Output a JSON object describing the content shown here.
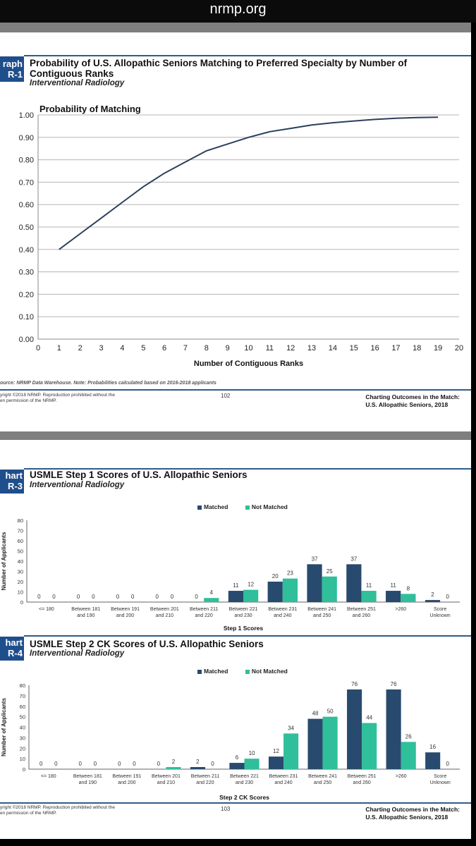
{
  "browser": {
    "url": "nrmp.org"
  },
  "colors": {
    "matched": "#284a6e",
    "not_matched": "#2fbf9a",
    "line": "#2b3f5c",
    "header_blue": "#1f4e8c"
  },
  "page1": {
    "tag_line1": "raph",
    "tag_line2": "R-1",
    "title_line1": "Probability of U.S. Allopathic Seniors Matching to Preferred Specialty by Number of",
    "title_line2": "Contiguous Ranks",
    "subtitle": "Interventional Radiology",
    "source": "ource: NRMP Data Warehouse. Note: Probabilities calculated based on 2016-2018 applicants",
    "copyright_line1": "yright ©2018 NRMP. Reproduction prohibited without the",
    "copyright_line2": "en permission of the NRMP.",
    "page_number": "102",
    "footer_title_line1": "Charting Outcomes in the Match:",
    "footer_title_line2": "U.S. Allopathic Seniors, 2018"
  },
  "page2": {
    "chart3": {
      "tag_line1": "hart",
      "tag_line2": "R-3",
      "title": "USMLE Step 1 Scores of U.S. Allopathic Seniors",
      "subtitle": "Interventional Radiology"
    },
    "chart4": {
      "tag_line1": "hart",
      "tag_line2": "R-4",
      "title": "USMLE Step 2 CK Scores of U.S. Allopathic Seniors",
      "subtitle": "Interventional Radiology"
    },
    "copyright_line1": "yright ©2018 NRMP. Reproduction prohibited without the",
    "copyright_line2": "en permission of the NRMP.",
    "page_number": "103",
    "footer_title_line1": "Charting Outcomes in the Match:",
    "footer_title_line2": "U.S. Allopathic Seniors, 2018"
  },
  "chart_data": [
    {
      "type": "line",
      "title": "Probability of Matching",
      "xlabel": "Number of Contiguous Ranks",
      "ylabel": "",
      "x": [
        1,
        2,
        3,
        4,
        5,
        6,
        7,
        8,
        9,
        10,
        11,
        12,
        13,
        14,
        15,
        16,
        17,
        18,
        19
      ],
      "series": [
        {
          "name": "Probability of Matching",
          "values": [
            0.4,
            0.47,
            0.54,
            0.61,
            0.68,
            0.74,
            0.79,
            0.84,
            0.87,
            0.9,
            0.925,
            0.94,
            0.955,
            0.965,
            0.973,
            0.98,
            0.985,
            0.988,
            0.99
          ]
        }
      ],
      "xlim": [
        0,
        20
      ],
      "ylim": [
        0,
        1
      ],
      "xticks": [
        "0",
        "1",
        "2",
        "3",
        "4",
        "5",
        "6",
        "7",
        "8",
        "9",
        "10",
        "11",
        "12",
        "13",
        "14",
        "15",
        "16",
        "17",
        "18",
        "19",
        "20"
      ],
      "yticks": [
        "0.00",
        "0.10",
        "0.20",
        "0.30",
        "0.40",
        "0.50",
        "0.60",
        "0.70",
        "0.80",
        "0.90",
        "1.00"
      ],
      "grid": true
    },
    {
      "type": "bar",
      "title": "USMLE Step 1 Scores of U.S. Allopathic Seniors",
      "xlabel": "Step 1 Scores",
      "ylabel": "Number of Applicants",
      "categories": [
        [
          "<= 180"
        ],
        [
          "Between 181",
          "and 190"
        ],
        [
          "Between 191",
          "and 200"
        ],
        [
          "Between 201",
          "and 210"
        ],
        [
          "Between 211",
          "and 220"
        ],
        [
          "Between 221",
          "and 230"
        ],
        [
          "Between 231",
          "and 240"
        ],
        [
          "Between 241",
          "and 250"
        ],
        [
          "Between 251",
          "and 260"
        ],
        [
          ">260"
        ],
        [
          "Score",
          "Unknown"
        ]
      ],
      "series": [
        {
          "name": "Matched",
          "values": [
            0,
            0,
            0,
            0,
            0,
            11,
            20,
            37,
            37,
            11,
            2
          ]
        },
        {
          "name": "Not Matched",
          "values": [
            0,
            0,
            0,
            0,
            4,
            12,
            23,
            25,
            11,
            8,
            0
          ]
        }
      ],
      "ylim": [
        0,
        80
      ],
      "yticks": [
        "0",
        "10",
        "20",
        "30",
        "40",
        "50",
        "60",
        "70",
        "80"
      ],
      "legend": "top-center",
      "grid": false
    },
    {
      "type": "bar",
      "title": "USMLE Step 2 CK Scores of U.S. Allopathic Seniors",
      "xlabel": "Step 2 CK Scores",
      "ylabel": "Number of Applicants",
      "categories": [
        [
          "<= 180"
        ],
        [
          "Between 181",
          "and 190"
        ],
        [
          "Between 191",
          "and 200"
        ],
        [
          "Between 201",
          "and 210"
        ],
        [
          "Between 211",
          "and 220"
        ],
        [
          "Between 221",
          "and 230"
        ],
        [
          "Between 231",
          "and 240"
        ],
        [
          "Between 241",
          "and 250"
        ],
        [
          "Between 251",
          "and 260"
        ],
        [
          ">260"
        ],
        [
          "Score",
          "Unknown"
        ]
      ],
      "series": [
        {
          "name": "Matched",
          "values": [
            0,
            0,
            0,
            0,
            2,
            6,
            12,
            48,
            76,
            76,
            16
          ]
        },
        {
          "name": "Not Matched",
          "values": [
            0,
            0,
            0,
            2,
            0,
            10,
            34,
            50,
            44,
            26,
            0
          ]
        }
      ],
      "ylim": [
        0,
        80
      ],
      "yticks": [
        "0",
        "10",
        "20",
        "30",
        "40",
        "50",
        "60",
        "70",
        "80"
      ],
      "legend": "top-center",
      "grid": false
    }
  ]
}
